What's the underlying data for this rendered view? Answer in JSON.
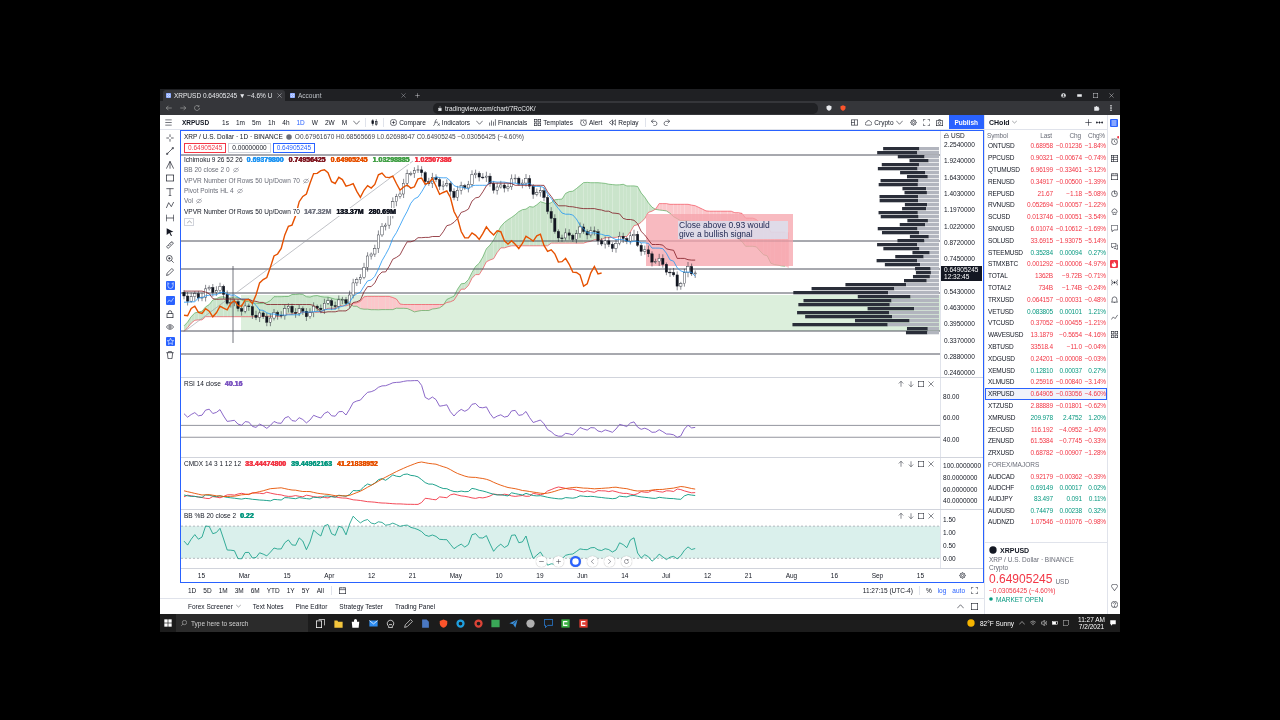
{
  "browser": {
    "tabs": [
      {
        "title": "XRPUSD 0.64905245 ▼ −4.6% U",
        "selected": true
      },
      {
        "title": "Account",
        "selected": false
      }
    ],
    "url": "tradingview.com/chart/7RcC0K/"
  },
  "toolbar": {
    "symbol": "XRPUSD",
    "intervals": [
      {
        "label": "1s",
        "selected": false
      },
      {
        "label": "1m",
        "selected": false
      },
      {
        "label": "5m",
        "selected": false
      },
      {
        "label": "1h",
        "selected": false
      },
      {
        "label": "4h",
        "selected": false
      },
      {
        "label": "1D",
        "selected": true
      },
      {
        "label": "W",
        "selected": false
      },
      {
        "label": "2W",
        "selected": false
      },
      {
        "label": "M",
        "selected": false
      }
    ],
    "buttons": [
      {
        "kind": "compare",
        "label": "Compare"
      },
      {
        "kind": "indicators",
        "label": "Indicators"
      },
      {
        "kind": "financials",
        "label": "Financials"
      },
      {
        "kind": "templates",
        "label": "Templates"
      },
      {
        "kind": "alert",
        "label": "Alert"
      },
      {
        "kind": "replay",
        "label": "Replay"
      }
    ],
    "layout_name": "Crypto",
    "publish": "Publish"
  },
  "chart": {
    "legend": {
      "title": "XRP / U.S. Dollar · 1D · BINANCE",
      "ohlc": "O0.67961670 H0.68565669 L0.62698647 C0.64905245 −0.03056425 (−4.60%)",
      "sell": "0.64905245",
      "spread": "0.00000000",
      "buy": "0.64905245"
    },
    "indicators": [
      {
        "name": "Ichimoku 9 26 52 26",
        "hidden": false,
        "values": [
          {
            "text": "0.69379800",
            "color": "#2196f3"
          },
          {
            "text": "0.74956425",
            "color": "#801922"
          },
          {
            "text": "0.64905245",
            "color": "#e65100"
          },
          {
            "text": "1.03298885",
            "color": "#43a047"
          },
          {
            "text": "1.02507386",
            "color": "#f23645"
          }
        ]
      },
      {
        "name": "BB 20 close 2 0",
        "hidden": true
      },
      {
        "name": "VPVR Number Of Rows 50 Up/Down 70",
        "hidden": true
      },
      {
        "name": "Pivot Points HL 4",
        "hidden": true
      },
      {
        "name": "Vol",
        "hidden": true
      },
      {
        "name": "VPVR Number Of Rows 50 Up/Down 70",
        "hidden": false,
        "values": [
          {
            "text": "147.32M",
            "color": "#787b86"
          },
          {
            "text": "133.37M",
            "color": "#131722"
          },
          {
            "text": "280.69M",
            "color": "#131722"
          }
        ]
      }
    ],
    "annotation": "Close above 0.93 would give a bullish signal",
    "currency": "USD",
    "price_labels": [
      "2.2540000",
      "1.9240000",
      "1.6430000",
      "1.4030000",
      "1.1970000",
      "1.0220000",
      "0.8720000",
      "0.7450000",
      "0.5430000",
      "0.4630000",
      "0.3950000",
      "0.3370000",
      "0.2880000",
      "0.2460000"
    ],
    "last_price": "0.64905245",
    "countdown": "12:32:45",
    "panes": [
      {
        "kind": "rsi",
        "name": "RSI 14 close",
        "values": [
          {
            "text": "40.16",
            "color": "#7e57c2"
          }
        ],
        "axis_labels": [
          "80.00",
          "60.00",
          "40.00"
        ]
      },
      {
        "kind": "dmi",
        "name": "CMDX 14 3 1 12 12",
        "values": [
          {
            "text": "33.44474800",
            "color": "#f23645"
          },
          {
            "text": "39.44962163",
            "color": "#089981"
          },
          {
            "text": "41.21838952",
            "color": "#e65100"
          }
        ],
        "axis_labels": [
          "100.0000000",
          "80.0000000",
          "60.0000000",
          "40.0000000"
        ]
      },
      {
        "kind": "percent_b",
        "name": "BB %B 20 close 2",
        "values": [
          {
            "text": "0.22",
            "color": "#089981"
          }
        ],
        "axis_labels": [
          "1.50",
          "1.00",
          "0.50",
          "0.00"
        ]
      }
    ],
    "time_labels": [
      "15",
      "Mar",
      "15",
      "Apr",
      "12",
      "21",
      "May",
      "10",
      "19",
      "Jun",
      "14",
      "Jul",
      "12",
      "21",
      "Aug",
      "16",
      "Sep",
      "15"
    ]
  },
  "range_bar": {
    "ranges": [
      "1D",
      "5D",
      "1M",
      "3M",
      "6M",
      "YTD",
      "1Y",
      "5Y",
      "All"
    ],
    "clock": "11:27:15 (UTC-4)",
    "scale_options": [
      {
        "label": "%",
        "selected": false
      },
      {
        "label": "log",
        "selected": true
      },
      {
        "label": "auto",
        "selected": true
      }
    ]
  },
  "bottom_tabs": [
    {
      "label": "Forex Screener",
      "dropdown": true
    },
    {
      "label": "Text Notes",
      "dropdown": false
    },
    {
      "label": "Pine Editor",
      "dropdown": false
    },
    {
      "label": "Strategy Tester",
      "dropdown": false
    },
    {
      "label": "Trading Panel",
      "dropdown": false
    }
  ],
  "watchlist": {
    "name": "CHold",
    "columns": [
      "Symbol",
      "Last",
      "Chg",
      "Chg%"
    ],
    "rows": [
      {
        "symbol": "ONTUSD",
        "last": "0.68958",
        "chg": "−0.01236",
        "chg_pct": "−1.84%",
        "up": false,
        "selected": false
      },
      {
        "symbol": "PPCUSD",
        "last": "0.90321",
        "chg": "−0.00674",
        "chg_pct": "−0.74%",
        "up": false,
        "selected": false
      },
      {
        "symbol": "QTUMUSD",
        "last": "6.96199",
        "chg": "−0.33461",
        "chg_pct": "−3.12%",
        "up": false,
        "selected": false
      },
      {
        "symbol": "RENUSD",
        "last": "0.34917",
        "chg": "−0.00500",
        "chg_pct": "−1.39%",
        "up": false,
        "selected": false
      },
      {
        "symbol": "REPUSD",
        "last": "21.67",
        "chg": "−1.18",
        "chg_pct": "−5.08%",
        "up": false,
        "selected": false
      },
      {
        "symbol": "RVNUSD",
        "last": "0.052694",
        "chg": "−0.00057",
        "chg_pct": "−1.22%",
        "up": false,
        "selected": false
      },
      {
        "symbol": "SCUSD",
        "last": "0.013746",
        "chg": "−0.00051",
        "chg_pct": "−3.54%",
        "up": false,
        "selected": false
      },
      {
        "symbol": "SNXUSD",
        "last": "6.01074",
        "chg": "−0.10612",
        "chg_pct": "−1.69%",
        "up": false,
        "selected": false
      },
      {
        "symbol": "SOLUSD",
        "last": "33.6915",
        "chg": "−1.93075",
        "chg_pct": "−5.14%",
        "up": false,
        "selected": false
      },
      {
        "symbol": "STEEMUSD",
        "last": "0.35284",
        "chg": "0.00094",
        "chg_pct": "0.27%",
        "up": true,
        "selected": false
      },
      {
        "symbol": "STMXBTC",
        "last": "0.001292",
        "chg": "−0.00006",
        "chg_pct": "−4.97%",
        "up": false,
        "selected": false
      },
      {
        "symbol": "TOTAL",
        "last": "1362B",
        "chg": "−9.72B",
        "chg_pct": "−0.71%",
        "up": false,
        "selected": false
      },
      {
        "symbol": "TOTAL2",
        "last": "734B",
        "chg": "−1.74B",
        "chg_pct": "−0.24%",
        "up": false,
        "selected": false
      },
      {
        "symbol": "TRXUSD",
        "last": "0.064157",
        "chg": "−0.00031",
        "chg_pct": "−0.48%",
        "up": false,
        "selected": false
      },
      {
        "symbol": "VETUSD",
        "last": "0.083805",
        "chg": "0.00101",
        "chg_pct": "1.21%",
        "up": true,
        "selected": false
      },
      {
        "symbol": "VTCUSD",
        "last": "0.37052",
        "chg": "−0.00455",
        "chg_pct": "−1.21%",
        "up": false,
        "selected": false
      },
      {
        "symbol": "WAVESUSD",
        "last": "13.1879",
        "chg": "−0.5654",
        "chg_pct": "−4.16%",
        "up": false,
        "selected": false
      },
      {
        "symbol": "XBTUSD",
        "last": "33518.4",
        "chg": "−11.0",
        "chg_pct": "−0.04%",
        "up": false,
        "selected": false
      },
      {
        "symbol": "XDGUSD",
        "last": "0.24201",
        "chg": "−0.00008",
        "chg_pct": "−0.03%",
        "up": false,
        "selected": false
      },
      {
        "symbol": "XEMUSD",
        "last": "0.12810",
        "chg": "0.00037",
        "chg_pct": "0.27%",
        "up": true,
        "selected": false
      },
      {
        "symbol": "XLMUSD",
        "last": "0.25916",
        "chg": "−0.00840",
        "chg_pct": "−3.14%",
        "up": false,
        "selected": false
      },
      {
        "symbol": "XRPUSD",
        "last": "0.64905",
        "chg": "−0.03056",
        "chg_pct": "−4.60%",
        "up": false,
        "selected": true
      },
      {
        "symbol": "XTZUSD",
        "last": "2.88889",
        "chg": "−0.01801",
        "chg_pct": "−0.62%",
        "up": false,
        "selected": false
      },
      {
        "symbol": "XMRUSD",
        "last": "209.978",
        "chg": "2.4752",
        "chg_pct": "1.20%",
        "up": true,
        "selected": false
      },
      {
        "symbol": "ZECUSD",
        "last": "116.192",
        "chg": "−4.0952",
        "chg_pct": "−1.40%",
        "up": false,
        "selected": false
      },
      {
        "symbol": "ZENUSD",
        "last": "61.5384",
        "chg": "−0.7745",
        "chg_pct": "−0.33%",
        "up": false,
        "selected": false
      },
      {
        "symbol": "ZRXUSD",
        "last": "0.68782",
        "chg": "−0.00907",
        "chg_pct": "−1.28%",
        "up": false,
        "selected": false
      }
    ],
    "section": {
      "title": "FOREX/MAJORS",
      "rows": [
        {
          "symbol": "AUDCAD",
          "last": "0.92179",
          "chg": "−0.00362",
          "chg_pct": "−0.39%",
          "up": false,
          "selected": false
        },
        {
          "symbol": "AUDCHF",
          "last": "0.69149",
          "chg": "0.00017",
          "chg_pct": "0.02%",
          "up": true,
          "selected": false
        },
        {
          "symbol": "AUDJPY",
          "last": "83.497",
          "chg": "0.091",
          "chg_pct": "0.11%",
          "up": true,
          "selected": false
        },
        {
          "symbol": "AUDUSD",
          "last": "0.74479",
          "chg": "0.00238",
          "chg_pct": "0.32%",
          "up": true,
          "selected": false
        },
        {
          "symbol": "AUDNZD",
          "last": "1.07546",
          "chg": "−0.01076",
          "chg_pct": "−0.98%",
          "up": false,
          "selected": false
        }
      ]
    }
  },
  "details": {
    "symbol": "XRPUSD",
    "description": "XRP / U.S. Dollar · BINANCE",
    "category": "Crypto",
    "price": "0.64905245",
    "currency": "USD",
    "change": "−0.03056425 (−4.60%)",
    "status": "MARKET OPEN"
  },
  "taskbar": {
    "search_placeholder": "Type here to search",
    "weather": "82°F Sunny",
    "time": "11:27 AM",
    "date": "7/2/2021"
  }
}
